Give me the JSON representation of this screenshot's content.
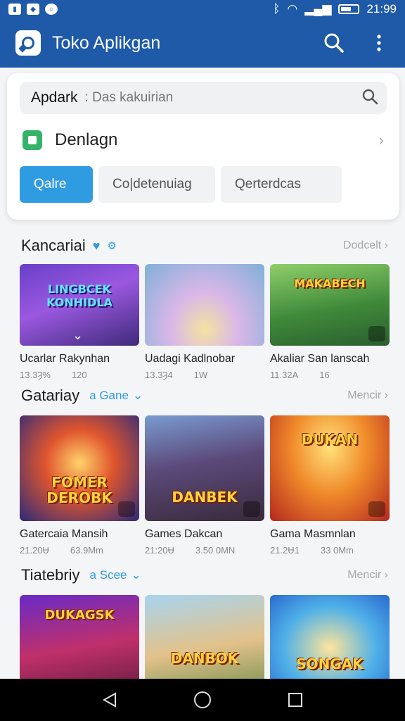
{
  "status_bar": {
    "time": "21:99"
  },
  "app_bar": {
    "title": "Toko Aplikgan"
  },
  "search": {
    "query": "Apdark",
    "placeholder": ": Das kakuirian"
  },
  "download_row": {
    "label": "Denlagn"
  },
  "chips": [
    "Qalre",
    "Co|detenuiag",
    "Qerterdcas"
  ],
  "sections": [
    {
      "title": "Kancariai",
      "more": "Dodcelt",
      "cards": [
        {
          "name": "Ucarlar Rakynhan",
          "meta1": "13.3Ȝ%",
          "meta2": "120",
          "art": "LINGBCEK\nKONHIDLA"
        },
        {
          "name": "Uadagi Kadlnobar",
          "meta1": "13.3Ȝ4",
          "meta2": "1W",
          "art": ""
        },
        {
          "name": "Akaliar San lanscah",
          "meta1": "11.32A",
          "meta2": "16",
          "art": "MAKABECH"
        }
      ]
    },
    {
      "title": "Gatariay",
      "sub": "a Gane",
      "more": "Mencir",
      "cards": [
        {
          "name": "Gatercaia Mansih",
          "meta1": "21.20Ʉ",
          "meta2": "63.9Mm",
          "art": "FOMER\nDEROBK"
        },
        {
          "name": "Games Dakcan",
          "meta1": "21:20Ʉ",
          "meta2": "3.50 0MN",
          "art": "DANBEK"
        },
        {
          "name": "Gama Masmnlan",
          "meta1": "21.2Ʉ1",
          "meta2": "33 0Mm",
          "art": "DUKAN"
        }
      ]
    },
    {
      "title": "Tiatebriy",
      "sub": "a Scee",
      "more": "Mencir",
      "cards": [
        {
          "art": "DUKAGSK"
        },
        {
          "art": "DANBOK"
        },
        {
          "art": "SONGAK"
        }
      ]
    }
  ],
  "colors": {
    "primary": "#1e5aa8",
    "accent": "#2f9be0",
    "download_green": "#36b36a"
  }
}
